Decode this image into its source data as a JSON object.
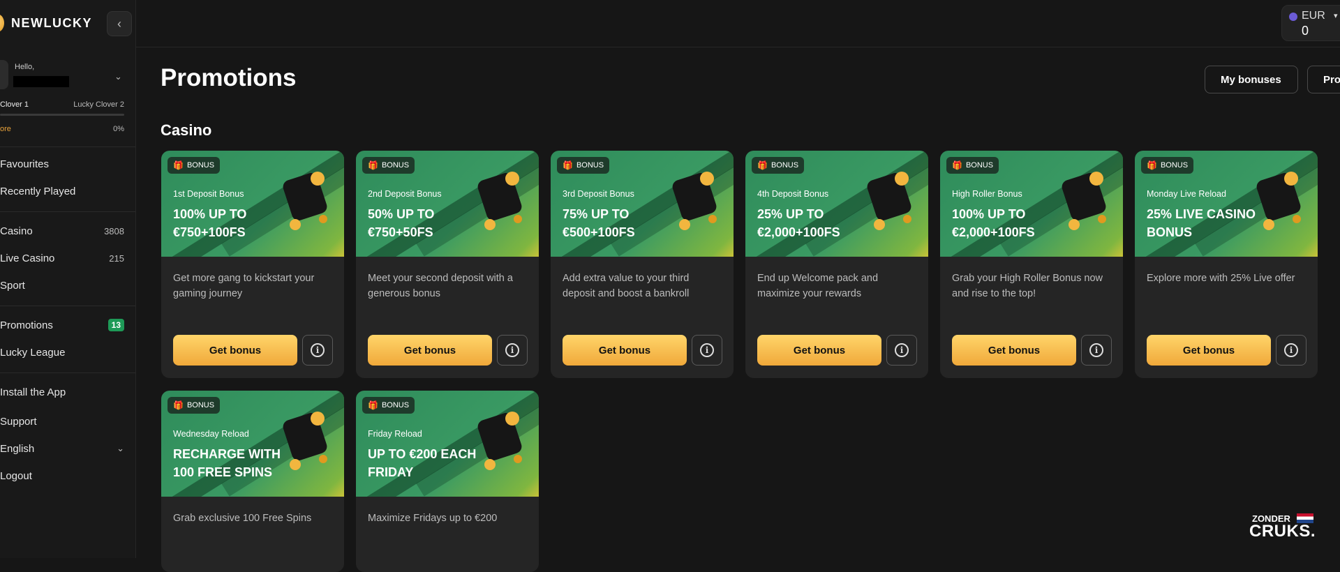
{
  "brand": {
    "name": "NEWLUCKY"
  },
  "sidebar": {
    "collapse_icon": "chevron-left-icon",
    "user": {
      "greeting": "Hello,"
    },
    "level": {
      "current": "Clover 1",
      "next": "Lucky Clover 2",
      "more": "ore",
      "percent": "0%",
      "progress": 0
    },
    "items": [
      {
        "label": "Favourites"
      },
      {
        "label": "Recently Played"
      },
      {
        "label": "Casino",
        "count": "3808"
      },
      {
        "label": "Live Casino",
        "count": "215"
      },
      {
        "label": "Sport"
      },
      {
        "label": "Promotions",
        "badge": "13"
      },
      {
        "label": "Lucky League"
      },
      {
        "label": "Install the App"
      },
      {
        "label": "Support"
      },
      {
        "label": "English"
      },
      {
        "label": "Logout"
      }
    ]
  },
  "wallet": {
    "currency": "EUR",
    "balance": "0"
  },
  "main": {
    "title": "Promotions",
    "my_bonuses": "My bonuses",
    "promo_partial": "Pro",
    "section": "Casino",
    "get_bonus_label": "Get bonus",
    "badge_label": "BONUS",
    "cards": [
      {
        "sub": "1st Deposit Bonus",
        "title": "100% UP TO €750+100FS",
        "desc": "Get more gang to kickstart your gaming journey"
      },
      {
        "sub": "2nd Deposit Bonus",
        "title": "50% UP TO €750+50FS",
        "desc": "Meet your second deposit with a generous bonus"
      },
      {
        "sub": "3rd Deposit Bonus",
        "title": "75% UP TO €500+100FS",
        "desc": "Add extra value to your third deposit and boost a bankroll"
      },
      {
        "sub": "4th Deposit Bonus",
        "title": "25% UP TO €2,000+100FS",
        "desc": "End up Welcome pack and maximize your rewards"
      },
      {
        "sub": "High Roller Bonus",
        "title": "100% UP TO €2,000+100FS",
        "desc": "Grab your High Roller Bonus now and rise to the top!"
      },
      {
        "sub": "Monday Live Reload",
        "title": "25% LIVE CASINO BONUS",
        "desc": "Explore more with 25% Live offer"
      },
      {
        "sub": "Wednesday Reload",
        "title": "RECHARGE WITH 100 FREE SPINS",
        "desc": "Grab exclusive 100 Free Spins"
      },
      {
        "sub": "Friday Reload",
        "title": "UP TO €200 EACH FRIDAY",
        "desc": "Maximize Fridays up to €200"
      }
    ]
  },
  "watermark": {
    "top": "ZONDER",
    "bottom": "CRUKS."
  }
}
